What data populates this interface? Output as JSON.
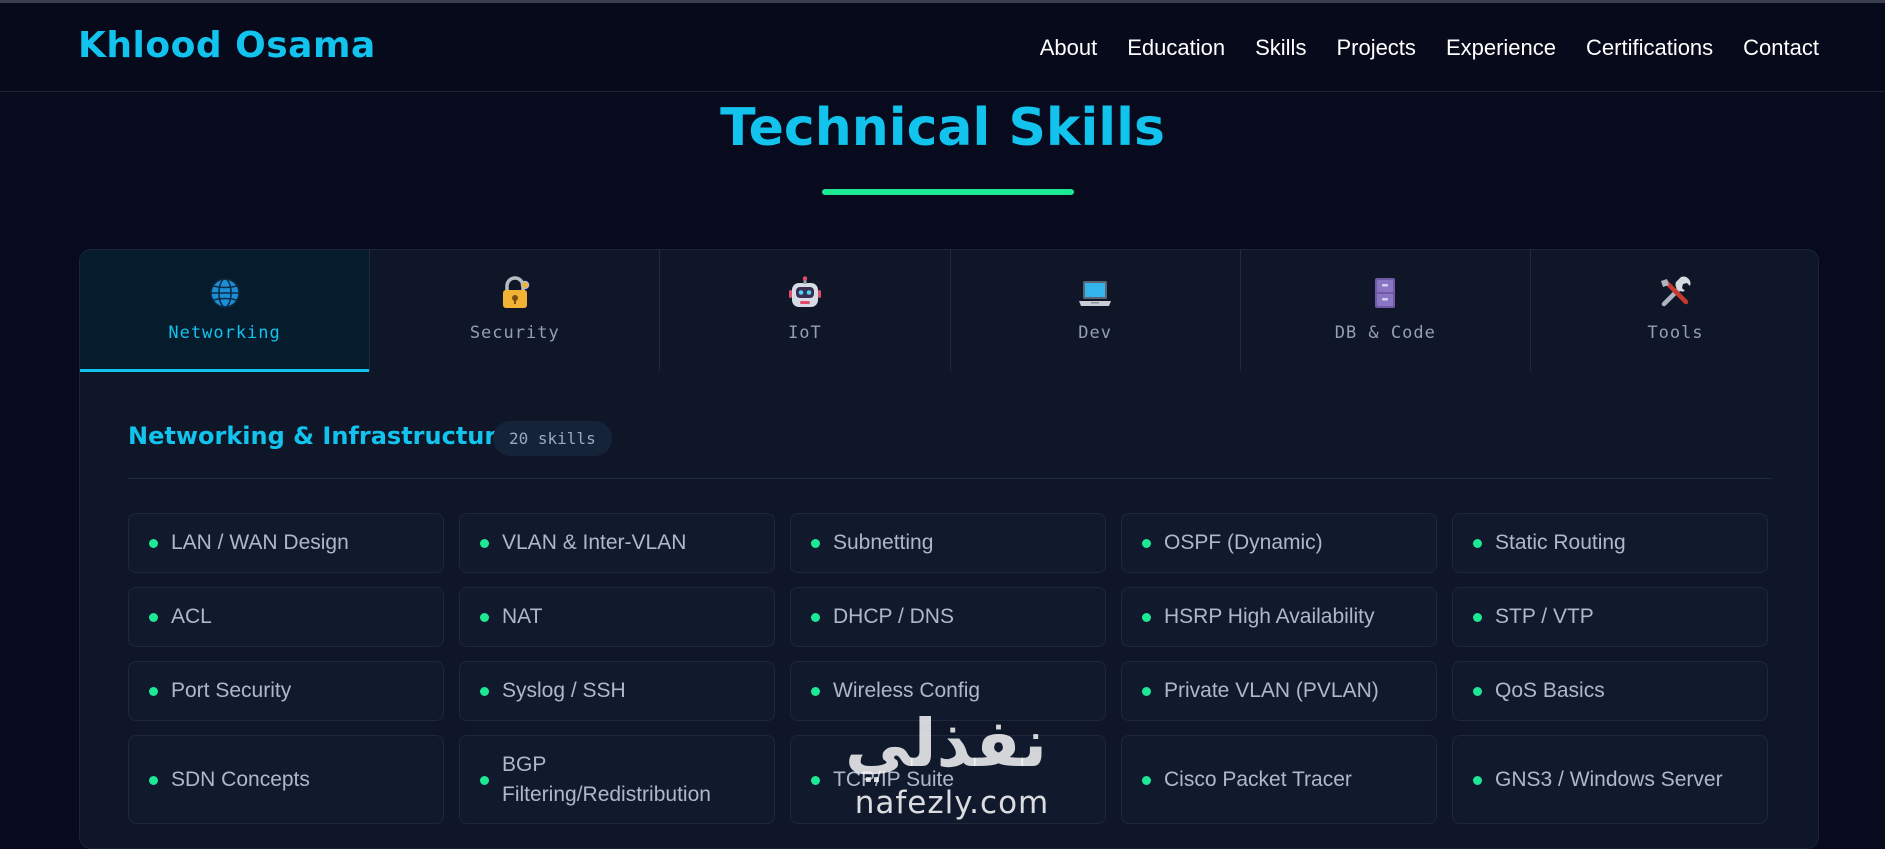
{
  "header": {
    "logo": "Khlood Osama",
    "nav": [
      "About",
      "Education",
      "Skills",
      "Projects",
      "Experience",
      "Certifications",
      "Contact"
    ]
  },
  "section": {
    "title": "Technical Skills"
  },
  "tabs": [
    {
      "label": "Networking",
      "icon": "globe-icon",
      "active": true
    },
    {
      "label": "Security",
      "icon": "lock-icon",
      "active": false
    },
    {
      "label": "IoT",
      "icon": "robot-icon",
      "active": false
    },
    {
      "label": "Dev",
      "icon": "laptop-icon",
      "active": false
    },
    {
      "label": "DB & Code",
      "icon": "file-cabinet-icon",
      "active": false
    },
    {
      "label": "Tools",
      "icon": "tools-icon",
      "active": false
    }
  ],
  "category": {
    "title": "Networking & Infrastructure",
    "count": "20 skills"
  },
  "skills": [
    "LAN / WAN Design",
    "VLAN & Inter-VLAN",
    "Subnetting",
    "OSPF (Dynamic)",
    "Static Routing",
    "ACL",
    "NAT",
    "DHCP / DNS",
    "HSRP High Availability",
    "STP / VTP",
    "Port Security",
    "Syslog / SSH",
    "Wireless Config",
    "Private VLAN (PVLAN)",
    "QoS Basics",
    "SDN Concepts",
    "BGP Filtering/Redistribution",
    "TCP/IP Suite",
    "Cisco Packet Tracer",
    "GNS3 / Windows Server"
  ],
  "watermark": {
    "arabic": "نفذلي",
    "latin": "nafezly.com"
  },
  "colors": {
    "accent": "#12c3ee",
    "green": "#1de995",
    "background": "#070b1d"
  }
}
